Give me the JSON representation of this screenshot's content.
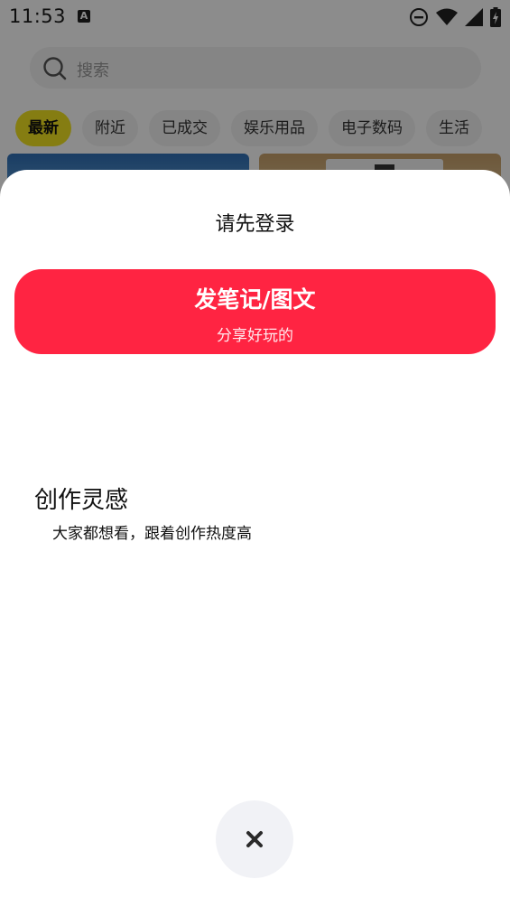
{
  "status_bar": {
    "time": "11:53",
    "notification_glyph": "A"
  },
  "search": {
    "placeholder": "搜索"
  },
  "tabs": [
    {
      "label": "最新",
      "active": true
    },
    {
      "label": "附近",
      "active": false
    },
    {
      "label": "已成交",
      "active": false
    },
    {
      "label": "娱乐用品",
      "active": false
    },
    {
      "label": "电子数码",
      "active": false
    },
    {
      "label": "生活",
      "active": false
    }
  ],
  "sheet": {
    "title": "请先登录",
    "post_button": {
      "title": "发笔记/图文",
      "subtitle": "分享好玩的"
    },
    "inspiration": {
      "title": "创作灵感",
      "description": "大家都想看，跟着创作热度高"
    },
    "close_icon": "close-icon"
  },
  "colors": {
    "accent_red": "#ff2442",
    "tab_active": "#f3e321",
    "close_bg": "#f1f2f6"
  }
}
